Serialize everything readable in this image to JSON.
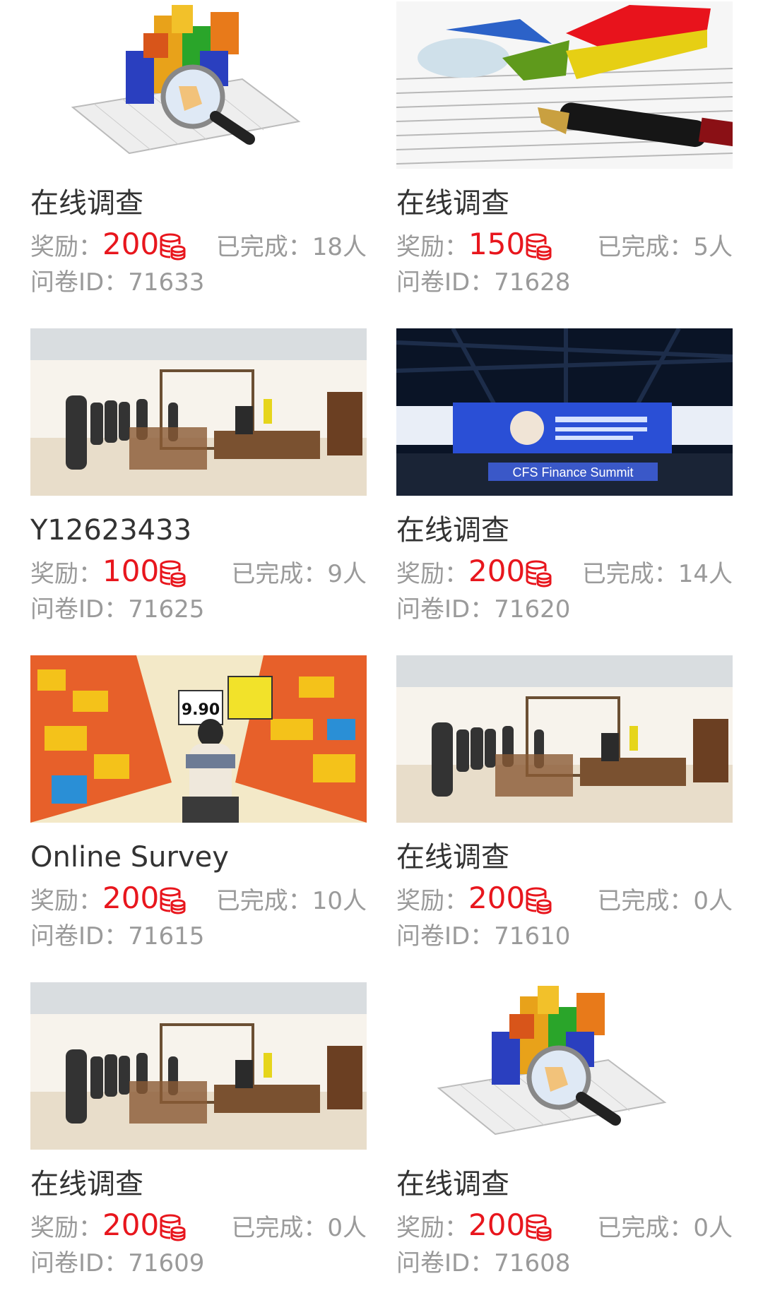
{
  "labels": {
    "reward": "奖励：",
    "completed": "已完成：",
    "completed_unit": "人",
    "questionnaire_id": "问卷ID："
  },
  "colors": {
    "reward_red": "#e8161d",
    "muted_gray": "#9a9a9a",
    "title_dark": "#333333"
  },
  "surveys": [
    {
      "title": "在线调查",
      "reward": "200",
      "completed": "18人",
      "id": "71633",
      "image": "bar-chart-magnifier"
    },
    {
      "title": "在线调查",
      "reward": "150",
      "completed": "5人",
      "id": "71628",
      "image": "pie-chart-pen"
    },
    {
      "title": "Y12623433",
      "reward": "100",
      "completed": "9人",
      "id": "71625",
      "image": "furniture-showroom"
    },
    {
      "title": "在线调查",
      "reward": "200",
      "completed": "14人",
      "id": "71620",
      "image": "finance-summit-stage",
      "image_text": "CFS Finance Summit"
    },
    {
      "title": "Online Survey",
      "reward": "200",
      "completed": "10人",
      "id": "71615",
      "image": "supermarket-aisle",
      "image_text": "9.90"
    },
    {
      "title": "在线调查",
      "reward": "200",
      "completed": "0人",
      "id": "71610",
      "image": "furniture-showroom"
    },
    {
      "title": "在线调查",
      "reward": "200",
      "completed": "0人",
      "id": "71609",
      "image": "furniture-showroom"
    },
    {
      "title": "在线调查",
      "reward": "200",
      "completed": "0人",
      "id": "71608",
      "image": "bar-chart-magnifier"
    }
  ]
}
